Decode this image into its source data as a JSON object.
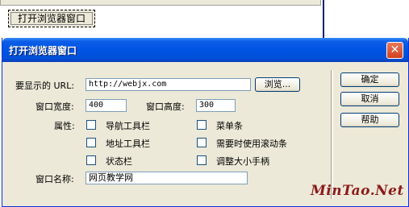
{
  "background": {
    "button_label": "打开浏览器窗口"
  },
  "dialog": {
    "title": "打开浏览器窗口",
    "close_glyph": "✕",
    "url_label": "要显示的 URL:",
    "url_value": "http://webjx.com",
    "browse_label": "浏览...",
    "width_label": "窗口宽度:",
    "width_value": "400",
    "height_label": "窗口高度:",
    "height_value": "300",
    "attributes_label": "属性:",
    "checkboxes": [
      {
        "label": "导航工具栏",
        "checked": false
      },
      {
        "label": "菜单条",
        "checked": false
      },
      {
        "label": "地址工具栏",
        "checked": false
      },
      {
        "label": "需要时使用滚动条",
        "checked": false
      },
      {
        "label": "状态栏",
        "checked": false
      },
      {
        "label": "调整大小手柄",
        "checked": false
      }
    ],
    "name_label": "窗口名称:",
    "name_value": "网页教学网",
    "buttons": {
      "ok": "确定",
      "cancel": "取消",
      "help": "帮助"
    }
  },
  "watermark": "MinTao.Net",
  "colors": {
    "titlebar": "#0054e3",
    "dialog_bg": "#ece9d8",
    "close_button": "#d2401e",
    "watermark": "#8b1a1a"
  }
}
